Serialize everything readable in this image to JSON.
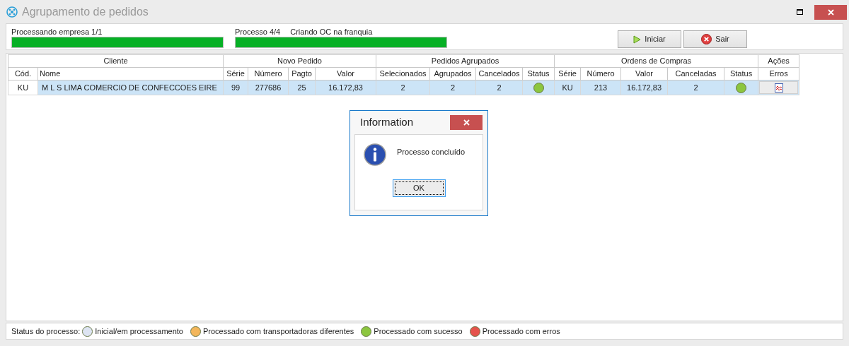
{
  "window": {
    "title": "Agrupamento de pedidos"
  },
  "progress": [
    {
      "label": "Processando empresa 1/1",
      "level": 1
    },
    {
      "label": "Processo 4/4",
      "detail": "Criando OC na franquia",
      "level": 1
    }
  ],
  "buttons": [
    {
      "label": "Iniciar",
      "kind": "play"
    },
    {
      "label": "Sair",
      "kind": "exit"
    }
  ],
  "table": {
    "groups": [
      {
        "label": "Cliente",
        "columns": [
          "Cód.",
          "Nome"
        ]
      },
      {
        "label": "Novo Pedido",
        "columns": [
          "Série",
          "Número",
          "Pagto",
          "Valor"
        ]
      },
      {
        "label": "Pedidos Agrupados",
        "columns": [
          "Selecionados",
          "Agrupados",
          "Cancelados",
          "Status"
        ]
      },
      {
        "label": "Ordens de Compras",
        "columns": [
          "Série",
          "Número",
          "Valor",
          "Canceladas",
          "Status"
        ]
      },
      {
        "label": "Ações",
        "columns": [
          "Erros"
        ]
      }
    ],
    "rows": [
      {
        "selected": true,
        "cells": [
          {
            "kind": "text",
            "text": "KU"
          },
          {
            "kind": "name",
            "text": "M L S LIMA COMERCIO DE CONFECCOES EIRE"
          },
          {
            "kind": "text",
            "text": "99"
          },
          {
            "kind": "text",
            "text": "277686"
          },
          {
            "kind": "text",
            "text": "25"
          },
          {
            "kind": "text",
            "text": "16.172,83"
          },
          {
            "kind": "text",
            "text": "2"
          },
          {
            "kind": "text",
            "text": "2"
          },
          {
            "kind": "text",
            "text": "2"
          },
          {
            "kind": "status",
            "color": "#8cc63f"
          },
          {
            "kind": "text",
            "text": "KU"
          },
          {
            "kind": "text",
            "text": "213"
          },
          {
            "kind": "text",
            "text": "16.172,83"
          },
          {
            "kind": "text",
            "text": "2"
          },
          {
            "kind": "status",
            "color": "#8cc63f"
          },
          {
            "kind": "action"
          }
        ]
      }
    ]
  },
  "legend": {
    "label": "Status do processo:",
    "items": [
      {
        "label": "Inicial/em processamento",
        "color": "#dde4f2"
      },
      {
        "label": "Processado com transportadoras diferentes",
        "color": "#f3b65a"
      },
      {
        "label": "Processado com sucesso",
        "color": "#8cc63f"
      },
      {
        "label": "Processado com erros",
        "color": "#e5534b"
      }
    ]
  },
  "dialog": {
    "title": "Information",
    "message": "Processo concluído",
    "button": "OK"
  }
}
